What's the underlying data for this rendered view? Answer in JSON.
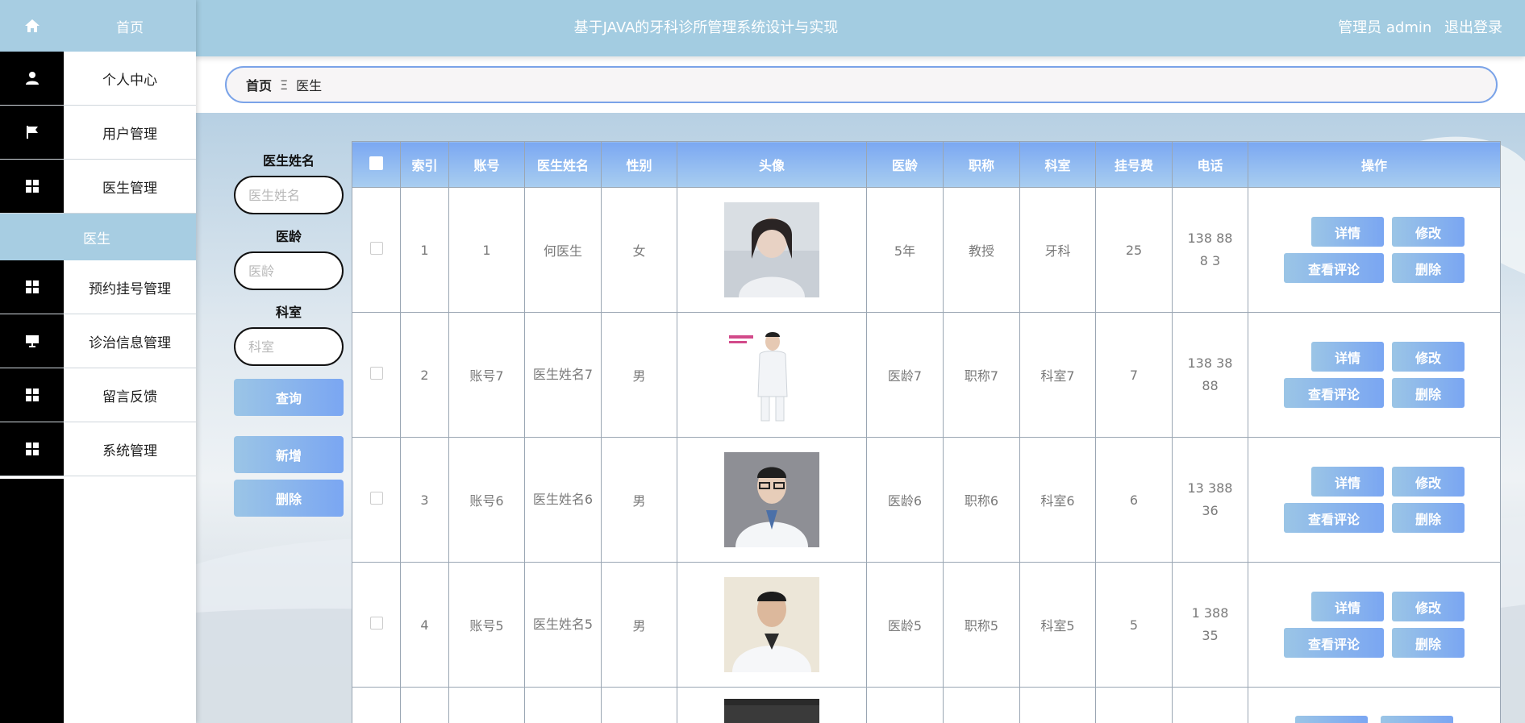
{
  "sidebar": {
    "home": "首页",
    "items": [
      {
        "label": "个人中心",
        "icon": "person-icon"
      },
      {
        "label": "用户管理",
        "icon": "flag-icon"
      },
      {
        "label": "医生管理",
        "icon": "grid-icon"
      },
      {
        "label": "预约挂号管理",
        "icon": "grid-icon"
      },
      {
        "label": "诊治信息管理",
        "icon": "monitor-icon"
      },
      {
        "label": "留言反馈",
        "icon": "grid-icon"
      },
      {
        "label": "系统管理",
        "icon": "grid-icon"
      }
    ],
    "sub_active": "医生"
  },
  "header": {
    "title": "基于JAVA的牙科诊所管理系统设计与实现",
    "user": "管理员 admin",
    "logout": "退出登录"
  },
  "breadcrumb": {
    "home": "首页",
    "sep": "Ξ",
    "current": "医生"
  },
  "search": {
    "name_label": "医生姓名",
    "name_placeholder": "医生姓名",
    "age_label": "医龄",
    "age_placeholder": "医龄",
    "dept_label": "科室",
    "dept_placeholder": "科室",
    "query": "查询",
    "add": "新增",
    "delete": "删除"
  },
  "table": {
    "headers": [
      "索引",
      "账号",
      "医生姓名",
      "性别",
      "头像",
      "医龄",
      "职称",
      "科室",
      "挂号费",
      "电话",
      "操作"
    ],
    "rows": [
      {
        "index": "1",
        "account": "1",
        "name": "何医生",
        "gender": "女",
        "age": "5年",
        "title": "教授",
        "dept": "牙科",
        "fee": "25",
        "phone": "138 88\n8 3"
      },
      {
        "index": "2",
        "account": "账号7",
        "name": "医生姓名7",
        "gender": "男",
        "age": "医龄7",
        "title": "职称7",
        "dept": "科室7",
        "fee": "7",
        "phone": "138 38\n88"
      },
      {
        "index": "3",
        "account": "账号6",
        "name": "医生姓名6",
        "gender": "男",
        "age": "医龄6",
        "title": "职称6",
        "dept": "科室6",
        "fee": "6",
        "phone": "13 388\n36"
      },
      {
        "index": "4",
        "account": "账号5",
        "name": "医生姓名5",
        "gender": "男",
        "age": "医龄5",
        "title": "职称5",
        "dept": "科室5",
        "fee": "5",
        "phone": "1 388\n35"
      }
    ],
    "ops": {
      "detail": "详情",
      "edit": "修改",
      "comments": "查看评论",
      "delete": "删除"
    }
  },
  "colors": {
    "accent": "#a3cce1",
    "button_start": "#9bc5e6",
    "button_end": "#7aa6f2",
    "header_th": "#7ba8f2"
  }
}
